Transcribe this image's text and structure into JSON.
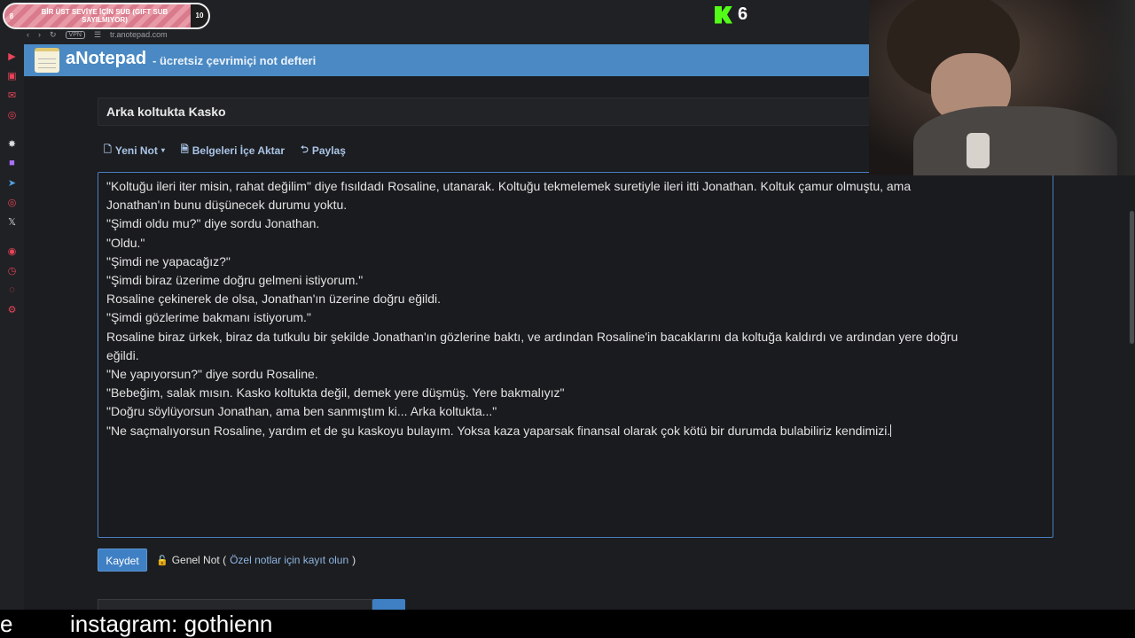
{
  "sub_banner": {
    "level_left": "8",
    "text": "BİR ÜST SEVİYE İÇİN SUB (GIFT SUB SAYILMIYOR)",
    "level_right": "10"
  },
  "browser": {
    "vpn_label": "VPN",
    "url": "tr.anotepad.com"
  },
  "kick": {
    "count": "6"
  },
  "site": {
    "brand": "aNotepad",
    "tagline": "- ücretsiz çevrimiçi not defteri"
  },
  "note": {
    "title": "Arka koltukta Kasko",
    "toolbar": {
      "new_note": "Yeni Not",
      "import_docs": "Belgeleri İçe Aktar",
      "share": "Paylaş"
    },
    "lines": [
      "\"Koltuğu ileri iter misin, rahat değilim\" diye fısıldadı Rosaline, utanarak. Koltuğu tekmelemek suretiyle ileri itti Jonathan. Koltuk çamur olmuştu, ama",
      "Jonathan'ın bunu düşünecek durumu yoktu.",
      "\"Şimdi oldu mu?\" diye sordu Jonathan.",
      "\"Oldu.\"",
      "\"Şimdi ne yapacağız?\"",
      "\"Şimdi biraz üzerime doğru gelmeni istiyorum.\"",
      "Rosaline çekinerek de olsa, Jonathan'ın üzerine doğru eğildi.",
      "\"Şimdi gözlerime bakmanı istiyorum.\"",
      "Rosaline biraz ürkek, biraz da tutkulu bir şekilde Jonathan'ın gözlerine baktı, ve ardından Rosaline'in bacaklarını da koltuğa kaldırdı ve ardından yere doğru",
      "eğildi.",
      "\"Ne yapıyorsun?\" diye sordu Rosaline.",
      "\"Bebeğim, salak mısın. Kasko koltukta değil, demek yere düşmüş. Yere bakmalıyız\"",
      "\"Doğru söylüyorsun Jonathan, ama ben sanmıştım ki... Arka koltukta...\"",
      "\"Ne saçmalıyorsun Rosaline, yardım et de şu kaskoyu bulayım. Yoksa kaza yaparsak finansal olarak çok kötü bir durumda bulabiliriz kendimizi."
    ],
    "save_label": "Kaydet",
    "public_note_label": "Genel Not (",
    "register_link": "Özel notlar için kayıt olun",
    "public_note_close": ")"
  },
  "stream": {
    "ticker_fragment": "e",
    "instagram": "instagram: gothienn"
  },
  "colors": {
    "header_blue": "#4a89c3",
    "save_blue": "#3f80c4",
    "kick_green": "#53fc18",
    "editor_border": "#4a7fc1"
  },
  "icons": [
    "youtube-icon",
    "twitch-icon",
    "telegram-icon",
    "instagram-icon",
    "x-icon",
    "share-icon",
    "document-icon",
    "import-icon",
    "lock-icon"
  ]
}
